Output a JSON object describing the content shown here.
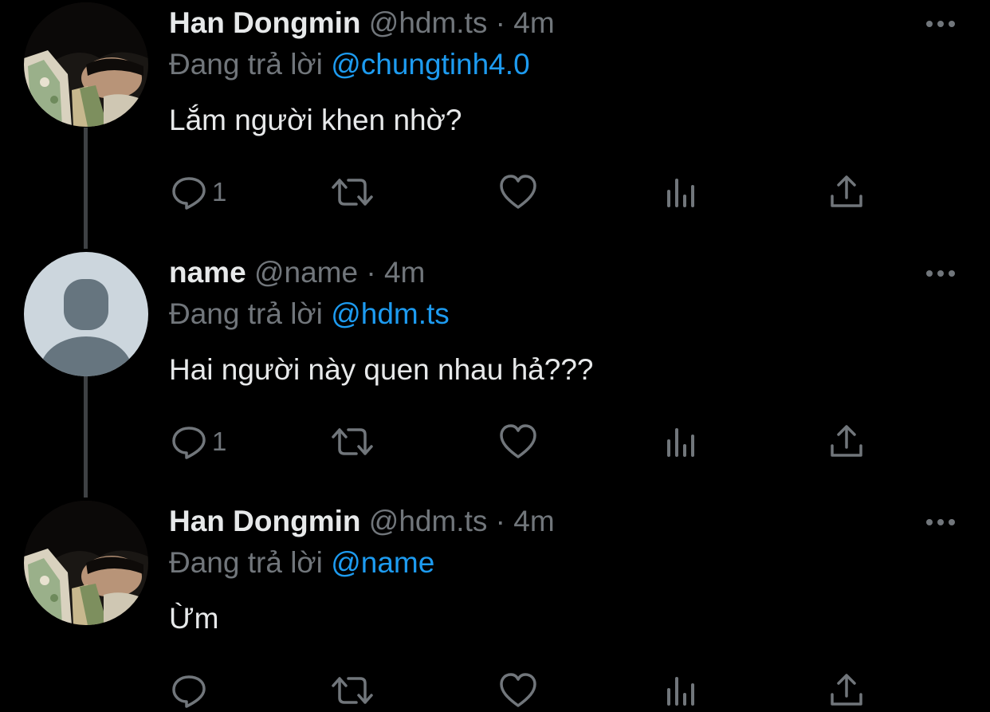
{
  "colors": {
    "background": "#000000",
    "text_primary": "#e7e9ea",
    "text_secondary": "#71767b",
    "mention": "#1d9bf0",
    "thread_line": "#3e4144"
  },
  "tweets": [
    {
      "avatar": "photo-avatar",
      "display_name": "Han Dongmin",
      "handle": "@hdm.ts",
      "separator": "·",
      "time": "4m",
      "reply_prefix": "Đang trả lời",
      "reply_to": "@chungtinh4.0",
      "text": "Lắm người khen nhờ?",
      "reply_count": "1"
    },
    {
      "avatar": "default-avatar",
      "display_name": "name",
      "handle": "@name",
      "separator": "·",
      "time": "4m",
      "reply_prefix": "Đang trả lời",
      "reply_to": "@hdm.ts",
      "text": "Hai người này quen nhau hả???",
      "reply_count": "1"
    },
    {
      "avatar": "photo-avatar",
      "display_name": "Han Dongmin",
      "handle": "@hdm.ts",
      "separator": "·",
      "time": "4m",
      "reply_prefix": "Đang trả lời",
      "reply_to": "@name",
      "text": "Ừm",
      "reply_count": ""
    }
  ],
  "icons": {
    "reply": "reply-icon",
    "retweet": "retweet-icon",
    "like": "heart-icon",
    "stats": "analytics-icon",
    "share": "share-icon",
    "more": "more-icon"
  }
}
